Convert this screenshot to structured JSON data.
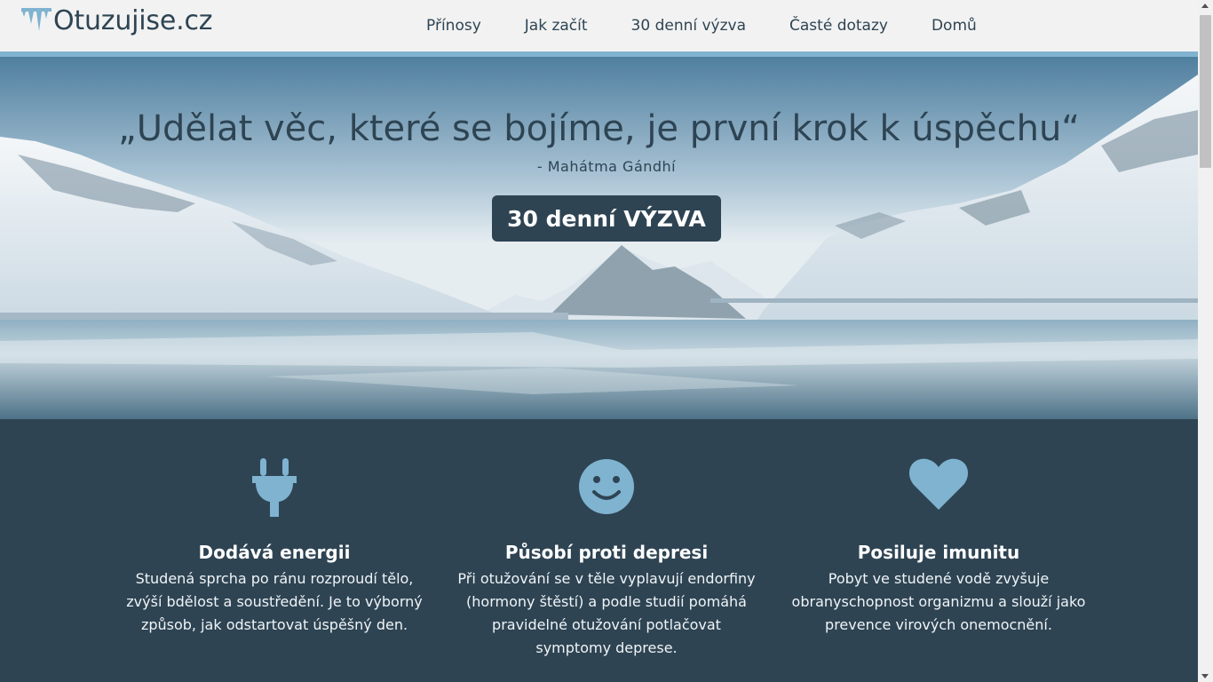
{
  "header": {
    "logo_text": "Otuzujise.cz",
    "nav": [
      "Přínosy",
      "Jak začít",
      "30 denní výzva",
      "Časté dotazy",
      "Domů"
    ]
  },
  "hero": {
    "quote": "„Udělat věc, které se bojíme, je první krok k úspěchu“",
    "author": "- Mahátma Gándhí",
    "cta_label": "30 denní VÝZVA"
  },
  "features": [
    {
      "icon": "plug-icon",
      "title": "Dodává energii",
      "text": "Studená sprcha po ránu rozproudí tělo, zvýší bdělost a soustředění. Je to výborný způsob, jak odstartovat úspěšný den."
    },
    {
      "icon": "smile-icon",
      "title": "Působí proti depresi",
      "text": "Při otužování se v těle vyplavují endorfiny (hormony štěstí) a podle studií pomáhá pravidelné otužování potlačovat symptomy deprese."
    },
    {
      "icon": "heart-icon",
      "title": "Posiluje imunitu",
      "text": "Pobyt ve studené vodě zvyšuje obranyschopnost organizmu a slouží jako prevence virových onemocnění."
    }
  ],
  "colors": {
    "dark": "#2e4453",
    "accent": "#7fb3d0",
    "header_bg": "#f2f2f2"
  }
}
